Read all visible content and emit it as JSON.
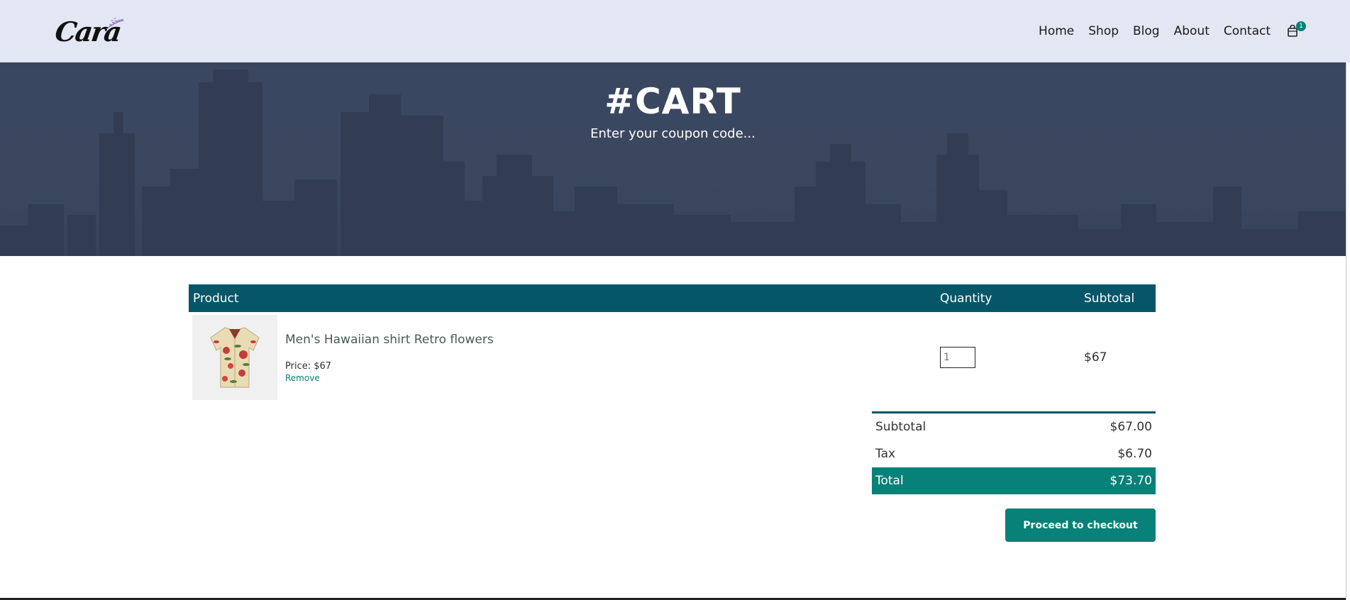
{
  "header": {
    "logo_text": "Cara",
    "nav": [
      "Home",
      "Shop",
      "Blog",
      "About",
      "Contact"
    ],
    "cart_count": "1"
  },
  "hero": {
    "title": "#CART",
    "subtitle": "Enter your coupon code..."
  },
  "cart": {
    "columns": {
      "product": "Product",
      "quantity": "Quantity",
      "subtotal": "Subtotal"
    },
    "items": [
      {
        "name": "Men's Hawaiian shirt Retro flowers",
        "price_label": "Price: $67",
        "remove_label": "Remove",
        "quantity": "1",
        "subtotal": "$67"
      }
    ]
  },
  "totals": {
    "subtotal_label": "Subtotal",
    "subtotal_value": "$67.00",
    "tax_label": "Tax",
    "tax_value": "$6.70",
    "total_label": "Total",
    "total_value": "$73.70"
  },
  "checkout_label": "Proceed to checkout",
  "colors": {
    "accent": "#088178",
    "table_header": "#055668",
    "header_bg": "#e3e6f3"
  },
  "icons": {
    "cart": "shopping-bag-icon",
    "logo_leaf": "lavender-icon"
  }
}
